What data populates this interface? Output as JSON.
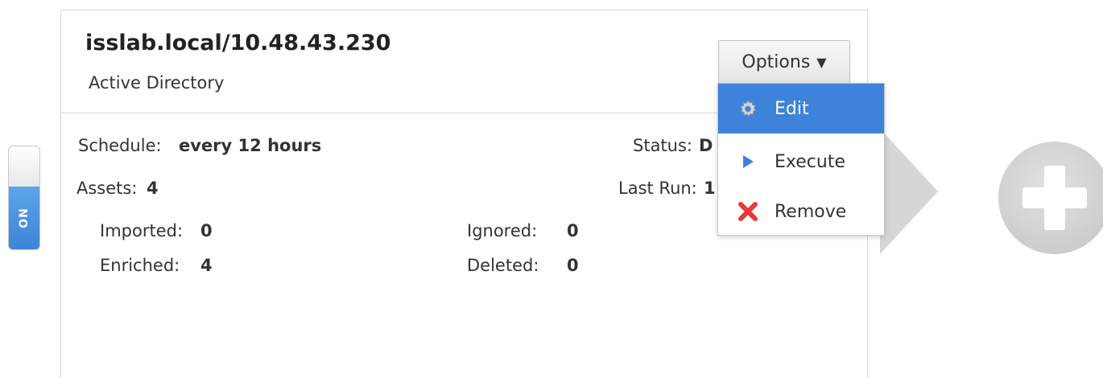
{
  "toggle": {
    "label": "ON"
  },
  "card": {
    "title": "isslab.local/10.48.43.230",
    "subtitle": "Active Directory",
    "options_label": "Options"
  },
  "details": {
    "schedule_label": "Schedule:",
    "schedule_value": "every 12 hours",
    "status_label": "Status:",
    "status_value_partial": "D",
    "assets_label": "Assets:",
    "assets_value": "4",
    "last_run_label": "Last Run:",
    "last_run_value_partial": "1",
    "imported_label": "Imported:",
    "imported_value": "0",
    "enriched_label": "Enriched:",
    "enriched_value": "4",
    "ignored_label": "Ignored:",
    "ignored_value": "0",
    "deleted_label": "Deleted:",
    "deleted_value": "0"
  },
  "menu": {
    "items": [
      {
        "label": "Edit",
        "icon": "gear-icon"
      },
      {
        "label": "Execute",
        "icon": "play-icon"
      },
      {
        "label": "Remove",
        "icon": "close-icon"
      }
    ]
  },
  "colors": {
    "accent": "#3e82da",
    "toggle_on": "#4a93e0",
    "remove_red": "#e5393b"
  }
}
